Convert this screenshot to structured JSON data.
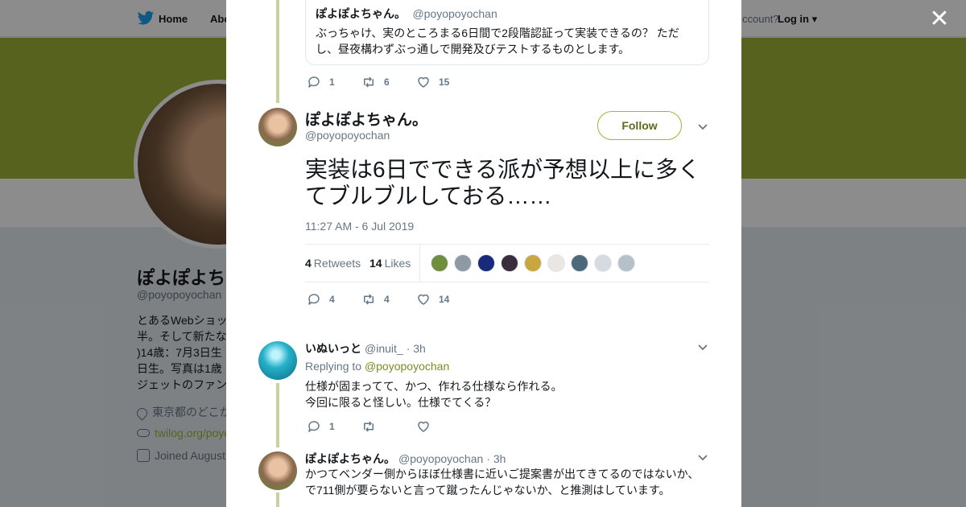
{
  "nav": {
    "home": "Home",
    "about": "Abo",
    "account": "ccount?",
    "login": "Log in"
  },
  "profile": {
    "name": "ぽよぽよち",
    "handle": "@poyopoyochan",
    "bio_lines": [
      "とあるWebショッ",
      "半。そして新たな",
      ")14歳：7月3日生",
      "日生。写真は1歳",
      "ジェットのファン"
    ],
    "location": "東京都のどこか",
    "website": "twilog.org/poyo",
    "joined": "Joined August"
  },
  "quoted_tweet": {
    "name": "ぽよぽよちゃん。",
    "handle": "@poyopoyochan",
    "text": "ぶっちゃけ、実のところまる6日間で2段階認証って実装できるの？ ただし、昼夜構わずぶっ通しで開発及びテストするものとします。",
    "replies": "1",
    "retweets": "6",
    "likes": "15"
  },
  "main_tweet": {
    "name": "ぽよぽよちゃん。",
    "handle": "@poyopoyochan",
    "follow_label": "Follow",
    "text": "実装は6日でできる派が予想以上に多くてブルブルしておる……",
    "timestamp": "11:27 AM - 6 Jul 2019",
    "retweet_count": "4",
    "retweet_label": "Retweets",
    "like_count": "14",
    "like_label": "Likes",
    "replies": "4",
    "retweets": "4",
    "likes": "14",
    "liker_colors": [
      "#6f8f3e",
      "#8e9aa3",
      "#1a2a7a",
      "#3a2e3e",
      "#c9a640",
      "#eae6e2",
      "#4d6a7c",
      "#d5dbe0",
      "#b6c0c8"
    ]
  },
  "replies": [
    {
      "name": "いぬいっと",
      "handle": "@inuit_",
      "time": "· 3h",
      "replying_prefix": "Replying to",
      "replying_to": "@poyopoyochan",
      "lines": [
        "仕様が固まってて、かつ、作れる仕様なら作れる。",
        "今回に限ると怪しい。仕様でてくる？"
      ],
      "replies": "1",
      "retweets": "",
      "likes": ""
    },
    {
      "name": "ぽよぽよちゃん。",
      "handle": "@poyopoyochan",
      "time": "· 3h",
      "lines": [
        "かつてベンダー側からほぼ仕様書に近いご提案書が出てきてるのではないか、",
        "で711側が要らないと言って蹴ったんじゃないか、と推測はしています。"
      ]
    }
  ],
  "colors": {
    "accent": "#a0b33a",
    "twitter_blue": "#1da1f2"
  }
}
